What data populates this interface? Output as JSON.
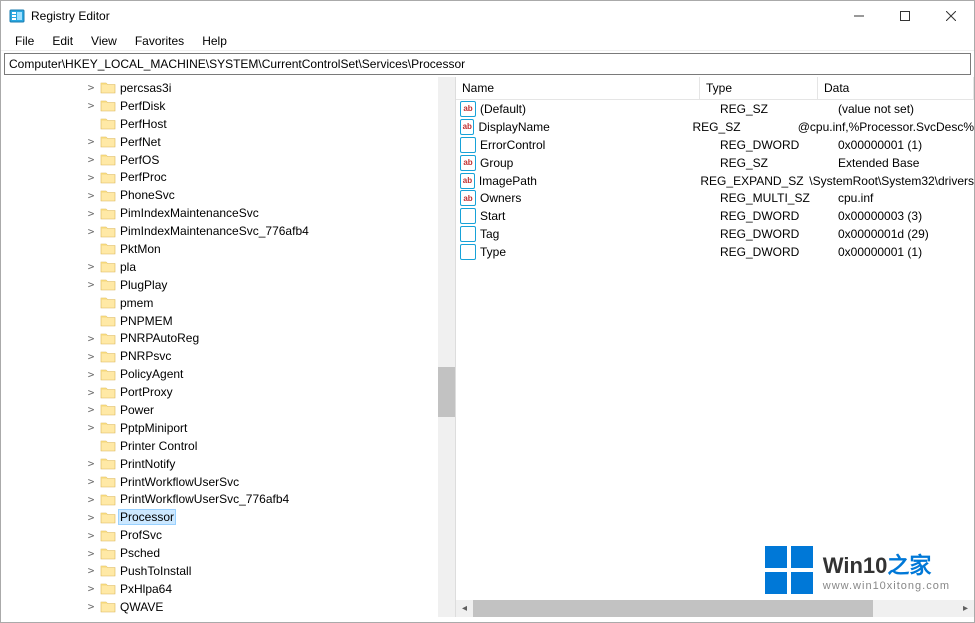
{
  "window": {
    "title": "Registry Editor"
  },
  "menu": {
    "file": "File",
    "edit": "Edit",
    "view": "View",
    "favorites": "Favorites",
    "help": "Help"
  },
  "address": "Computer\\HKEY_LOCAL_MACHINE\\SYSTEM\\CurrentControlSet\\Services\\Processor",
  "tree": [
    {
      "label": "percsas3i",
      "exp": true
    },
    {
      "label": "PerfDisk",
      "exp": true
    },
    {
      "label": "PerfHost",
      "exp": false
    },
    {
      "label": "PerfNet",
      "exp": true
    },
    {
      "label": "PerfOS",
      "exp": true
    },
    {
      "label": "PerfProc",
      "exp": true
    },
    {
      "label": "PhoneSvc",
      "exp": true
    },
    {
      "label": "PimIndexMaintenanceSvc",
      "exp": true
    },
    {
      "label": "PimIndexMaintenanceSvc_776afb4",
      "exp": true
    },
    {
      "label": "PktMon",
      "exp": false
    },
    {
      "label": "pla",
      "exp": true
    },
    {
      "label": "PlugPlay",
      "exp": true
    },
    {
      "label": "pmem",
      "exp": false
    },
    {
      "label": "PNPMEM",
      "exp": false
    },
    {
      "label": "PNRPAutoReg",
      "exp": true
    },
    {
      "label": "PNRPsvc",
      "exp": true
    },
    {
      "label": "PolicyAgent",
      "exp": true
    },
    {
      "label": "PortProxy",
      "exp": true
    },
    {
      "label": "Power",
      "exp": true
    },
    {
      "label": "PptpMiniport",
      "exp": true
    },
    {
      "label": "Printer Control",
      "exp": false
    },
    {
      "label": "PrintNotify",
      "exp": true
    },
    {
      "label": "PrintWorkflowUserSvc",
      "exp": true
    },
    {
      "label": "PrintWorkflowUserSvc_776afb4",
      "exp": true
    },
    {
      "label": "Processor",
      "exp": true,
      "sel": true
    },
    {
      "label": "ProfSvc",
      "exp": true
    },
    {
      "label": "Psched",
      "exp": true
    },
    {
      "label": "PushToInstall",
      "exp": true
    },
    {
      "label": "PxHlpa64",
      "exp": true
    },
    {
      "label": "QWAVE",
      "exp": true
    }
  ],
  "columns": {
    "name": "Name",
    "type": "Type",
    "data": "Data"
  },
  "values": [
    {
      "icon": "ab",
      "name": "(Default)",
      "type": "REG_SZ",
      "data": "(value not set)"
    },
    {
      "icon": "ab",
      "name": "DisplayName",
      "type": "REG_SZ",
      "data": "@cpu.inf,%Processor.SvcDesc%"
    },
    {
      "icon": "bin",
      "name": "ErrorControl",
      "type": "REG_DWORD",
      "data": "0x00000001 (1)"
    },
    {
      "icon": "ab",
      "name": "Group",
      "type": "REG_SZ",
      "data": "Extended Base"
    },
    {
      "icon": "ab",
      "name": "ImagePath",
      "type": "REG_EXPAND_SZ",
      "data": "\\SystemRoot\\System32\\drivers"
    },
    {
      "icon": "ab",
      "name": "Owners",
      "type": "REG_MULTI_SZ",
      "data": "cpu.inf"
    },
    {
      "icon": "bin",
      "name": "Start",
      "type": "REG_DWORD",
      "data": "0x00000003 (3)"
    },
    {
      "icon": "bin",
      "name": "Tag",
      "type": "REG_DWORD",
      "data": "0x0000001d (29)"
    },
    {
      "icon": "bin",
      "name": "Type",
      "type": "REG_DWORD",
      "data": "0x00000001 (1)"
    }
  ],
  "watermark": {
    "brand": "Win10",
    "suffix": "之家",
    "url": "www.win10xitong.com"
  }
}
